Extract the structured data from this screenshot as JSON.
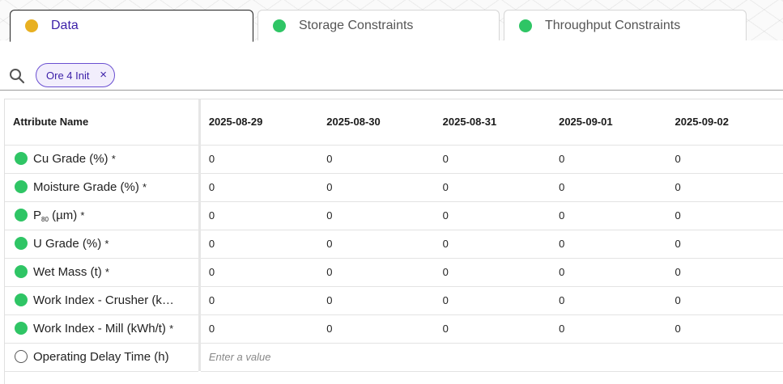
{
  "tabs": [
    {
      "label": "Data",
      "dot_color": "#e8b021"
    },
    {
      "label": "Storage Constraints",
      "dot_color": "#2fc565"
    },
    {
      "label": "Throughput Constraints",
      "dot_color": "#2fc565"
    }
  ],
  "filter": {
    "chip_label": "Ore 4 Init",
    "chip_close": "×"
  },
  "table": {
    "header_name": "Attribute Name",
    "dates": [
      "2025-08-29",
      "2025-08-30",
      "2025-08-31",
      "2025-09-01",
      "2025-09-02"
    ],
    "rows": [
      {
        "name": "Cu Grade (%)",
        "req": "*",
        "values": [
          "0",
          "0",
          "0",
          "0",
          "0"
        ]
      },
      {
        "name": "Moisture Grade (%)",
        "req": "*",
        "values": [
          "0",
          "0",
          "0",
          "0",
          "0"
        ]
      },
      {
        "name_main": "P",
        "name_sub": "80",
        "name_unit": " (µm)",
        "req": "*",
        "values": [
          "0",
          "0",
          "0",
          "0",
          "0"
        ]
      },
      {
        "name": "U Grade (%)",
        "req": "*",
        "values": [
          "0",
          "0",
          "0",
          "0",
          "0"
        ]
      },
      {
        "name": "Wet Mass (t)",
        "req": "*",
        "values": [
          "0",
          "0",
          "0",
          "0",
          "0"
        ]
      },
      {
        "name": "Work Index - Crusher (k…",
        "req": "",
        "values": [
          "0",
          "0",
          "0",
          "0",
          "0"
        ]
      },
      {
        "name": "Work Index - Mill (kWh/t)",
        "req": "*",
        "values": [
          "0",
          "0",
          "0",
          "0",
          "0"
        ]
      },
      {
        "name": "Operating Delay Time (h)",
        "req": "",
        "placeholder": "Enter a value"
      }
    ]
  },
  "colors": {
    "ok": "#2fc565",
    "accent": "#3b1fa8",
    "pending": "#e8b021"
  }
}
